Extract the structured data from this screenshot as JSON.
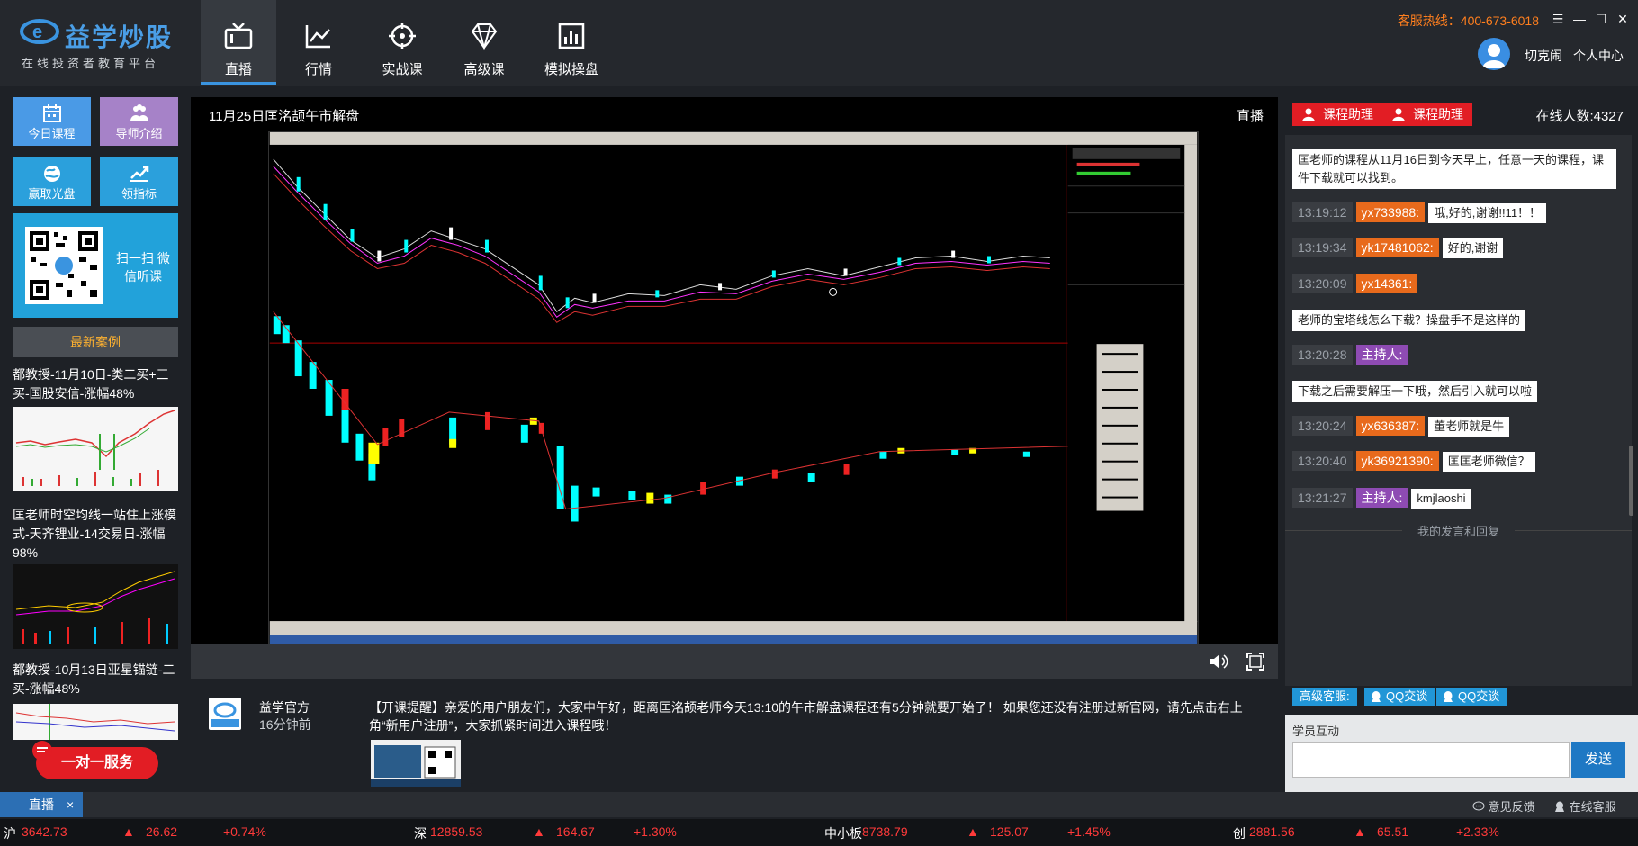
{
  "brand": {
    "name": "益学炒股",
    "subtitle": "在线投资者教育平台"
  },
  "nav": [
    {
      "label": "直播",
      "icon": "tv-icon",
      "active": true
    },
    {
      "label": "行情",
      "icon": "line-chart-icon"
    },
    {
      "label": "实战课",
      "icon": "crosshair-icon"
    },
    {
      "label": "高级课",
      "icon": "diamond-icon"
    },
    {
      "label": "模拟操盘",
      "icon": "bar-chart-icon"
    }
  ],
  "header": {
    "hotline": "客服热线：400-673-6018",
    "username": "切克闹",
    "user_center": "个人中心"
  },
  "sidebar": {
    "buttons": [
      {
        "label": "今日课程",
        "color": "#4a9ae6",
        "icon": "calendar-icon"
      },
      {
        "label": "导师介绍",
        "color": "#a682c8",
        "icon": "people-icon"
      },
      {
        "label": "赢取光盘",
        "color": "#2ba0dc",
        "icon": "globe-icon"
      },
      {
        "label": "领指标",
        "color": "#2ba0dc",
        "icon": "trend-icon"
      }
    ],
    "qr_text": "扫一扫 微信听课",
    "cases_title": "最新案例",
    "cases": [
      {
        "title": "都教授-11月10日-类二买+三买-国股安信-涨幅48%"
      },
      {
        "title": "匡老师时空均线一站住上涨模式-天齐锂业-14交易日-涨幅98%"
      },
      {
        "title": "都教授-10月13日亚星锚链-二买-涨幅48%"
      }
    ],
    "service_button": "一对一服务"
  },
  "video": {
    "title": "11月25日匡洺颉午市解盘",
    "badge": "直播"
  },
  "announcement": {
    "name": "益学官方",
    "time": "16分钟前",
    "text": "【开课提醒】亲爱的用户朋友们，大家中午好，距离匡洺颉老师今天13:10的午市解盘课程还有5分钟就要开始了！ 如果您还没有注册过新官网，请先点击右上角“新用户注册”，大家抓紧时间进入课程哦！",
    "avatar_text": "益学星"
  },
  "chat": {
    "assistant_label": "课程助理",
    "online": "在线人数:4327",
    "system_msgs": [
      "匡老师的课程从11月16日到今天早上，任意一天的课程，课件下载就可以找到。",
      "老师的宝塔线怎么下载？操盘手不是这样的",
      "下载之后需要解压一下哦，然后引入就可以啦"
    ],
    "messages": [
      {
        "time": "13:19:12",
        "user": "yx733988:",
        "text": "哦,好的,谢谢!!11！！"
      },
      {
        "time": "13:19:34",
        "user": "yk17481062:",
        "text": "好的,谢谢"
      },
      {
        "time": "13:20:09",
        "user": "yx14361:",
        "text": ""
      },
      {
        "time": "13:20:28",
        "user": "主持人:",
        "text": "",
        "host": true
      },
      {
        "time": "13:20:24",
        "user": "yx636387:",
        "text": "董老师就是牛"
      },
      {
        "time": "13:20:40",
        "user": "yk36921390:",
        "text": "匡匡老师微信？"
      },
      {
        "time": "13:21:27",
        "user": "主持人:",
        "text": "kmjlaoshi",
        "host": true
      }
    ],
    "divider": "我的发言和回复",
    "service_label": "高级客服:",
    "qq1": "QQ交谈",
    "qq2": "QQ交谈",
    "interact_label": "学员互动",
    "send": "发送"
  },
  "tabs": {
    "live": "直播",
    "close": "×"
  },
  "footer": {
    "feedback": "意见反馈",
    "online_service": "在线客服"
  },
  "ticker": [
    {
      "name": "沪",
      "price": "3642.73",
      "change": "26.62",
      "pct": "+0.74%"
    },
    {
      "name": "深",
      "price": "12859.53",
      "change": "164.67",
      "pct": "+1.30%"
    },
    {
      "name": "中小板",
      "price": "8738.79",
      "change": "125.07",
      "pct": "+1.45%"
    },
    {
      "name": "创",
      "price": "2881.56",
      "change": "65.51",
      "pct": "+2.33%"
    }
  ]
}
